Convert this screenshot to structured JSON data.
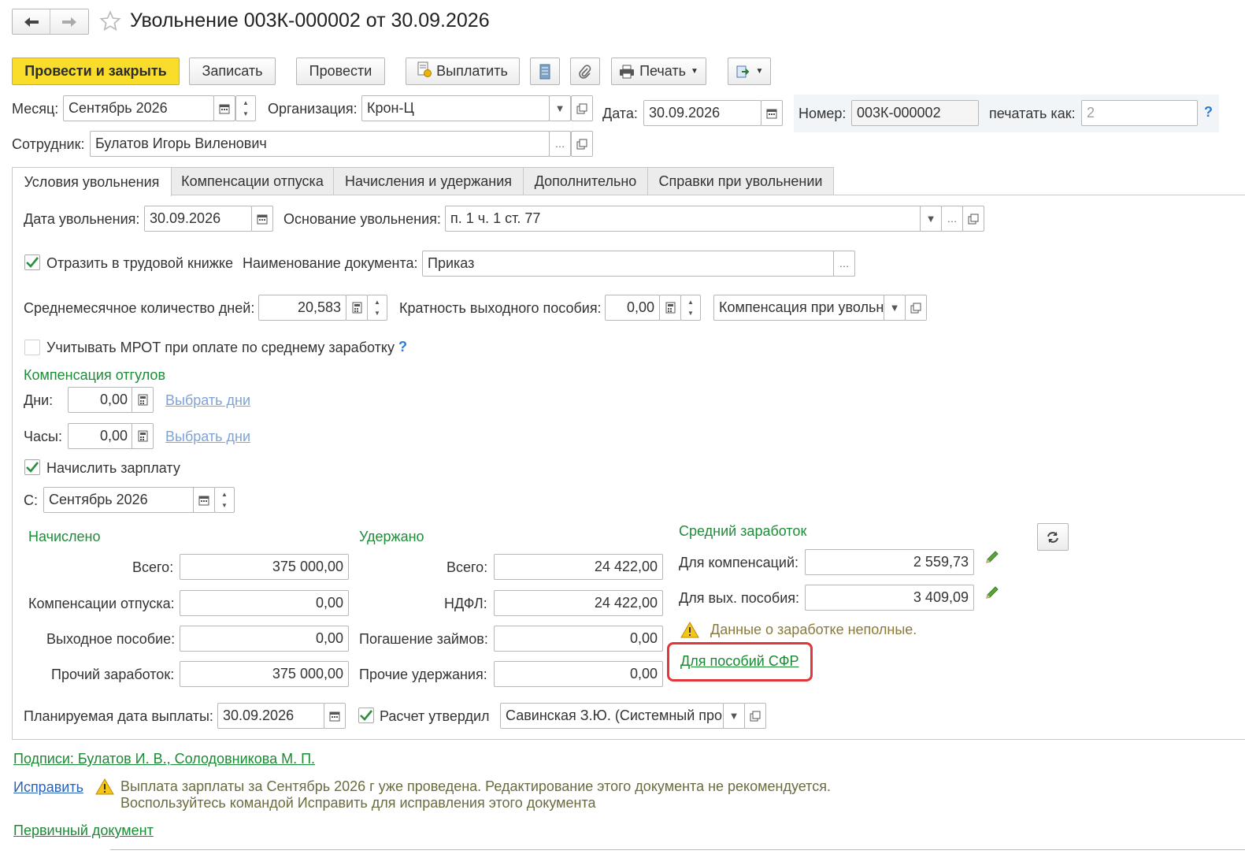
{
  "window": {
    "title": "Увольнение 003К-000002 от 30.09.2026"
  },
  "toolbar": {
    "post_close": "Провести и закрыть",
    "save": "Записать",
    "post": "Провести",
    "pay": "Выплатить",
    "print": "Печать"
  },
  "header": {
    "month_label": "Месяц:",
    "month_value": "Сентябрь 2026",
    "org_label": "Организация:",
    "org_value": "Крон-Ц",
    "date_label": "Дата:",
    "date_value": "30.09.2026",
    "number_label": "Номер:",
    "number_value": "003К-000002",
    "print_as_label": "печатать как:",
    "print_as_placeholder": "2",
    "employee_label": "Сотрудник:",
    "employee_value": "Булатов Игорь Виленович"
  },
  "tabs": [
    {
      "label": "Условия увольнения",
      "active": true
    },
    {
      "label": "Компенсации отпуска",
      "active": false
    },
    {
      "label": "Начисления и удержания",
      "active": false
    },
    {
      "label": "Дополнительно",
      "active": false
    },
    {
      "label": "Справки при увольнении",
      "active": false
    }
  ],
  "conditions": {
    "dismissal_date_label": "Дата увольнения:",
    "dismissal_date_value": "30.09.2026",
    "basis_label": "Основание увольнения:",
    "basis_value": "п. 1 ч. 1 ст. 77",
    "workbook_checkbox_label": "Отразить в трудовой книжке",
    "workbook_checked": true,
    "doc_name_label": "Наименование документа:",
    "doc_name_value": "Приказ",
    "avg_days_label": "Среднемесячное количество дней:",
    "avg_days_value": "20,583",
    "severance_mult_label": "Кратность выходного пособия:",
    "severance_mult_value": "0,00",
    "severance_kind_value": "Компенсация при увольн",
    "mrot_label": "Учитывать МРОТ при оплате по среднему заработку",
    "mrot_checked": false,
    "comp_section_title": "Компенсация отгулов",
    "days_label": "Дни:",
    "days_value": "0,00",
    "hours_label": "Часы:",
    "hours_value": "0,00",
    "select_days_link": "Выбрать дни",
    "accrue_salary_label": "Начислить зарплату",
    "accrue_salary_checked": true,
    "from_label": "С:",
    "from_value": "Сентябрь 2026"
  },
  "accrued": {
    "title": "Начислено",
    "total_label": "Всего:",
    "total_value": "375 000,00",
    "vacation_comp_label": "Компенсации отпуска:",
    "vacation_comp_value": "0,00",
    "severance_label": "Выходное пособие:",
    "severance_value": "0,00",
    "other_label": "Прочий заработок:",
    "other_value": "375 000,00"
  },
  "withheld": {
    "title": "Удержано",
    "total_label": "Всего:",
    "total_value": "24 422,00",
    "ndfl_label": "НДФЛ:",
    "ndfl_value": "24 422,00",
    "loans_label": "Погашение займов:",
    "loans_value": "0,00",
    "other_label": "Прочие удержания:",
    "other_value": "0,00"
  },
  "avg_earnings": {
    "title": "Средний заработок",
    "comp_label": "Для компенсаций:",
    "comp_value": "2 559,73",
    "severance_label": "Для вых. пособия:",
    "severance_value": "3 409,09",
    "warning": "Данные о заработке неполные.",
    "sfr_link": "Для пособий СФР"
  },
  "payment": {
    "planned_date_label": "Планируемая дата выплаты:",
    "planned_date_value": "30.09.2026",
    "approved_label": "Расчет утвердил",
    "approved_checked": true,
    "approver_value": "Савинская З.Ю. (Системный про"
  },
  "footer": {
    "signatures_link": "Подписи: Булатов И. В., Солодовникова М. П.",
    "fix_link": "Исправить",
    "warning_line1": "Выплата зарплаты за Сентябрь 2026 г уже проведена. Редактирование этого документа не рекомендуется.",
    "warning_line2": "Воспользуйтесь командой Исправить для исправления этого документа",
    "primary_doc_link": "Первичный документ"
  },
  "colors": {
    "primary_button": "#fadd2a",
    "section_title_green": "#1f8c3a",
    "link_blue": "#2a62b8",
    "highlight_red": "#e0363c",
    "warning_yellow": "#f5c518"
  }
}
